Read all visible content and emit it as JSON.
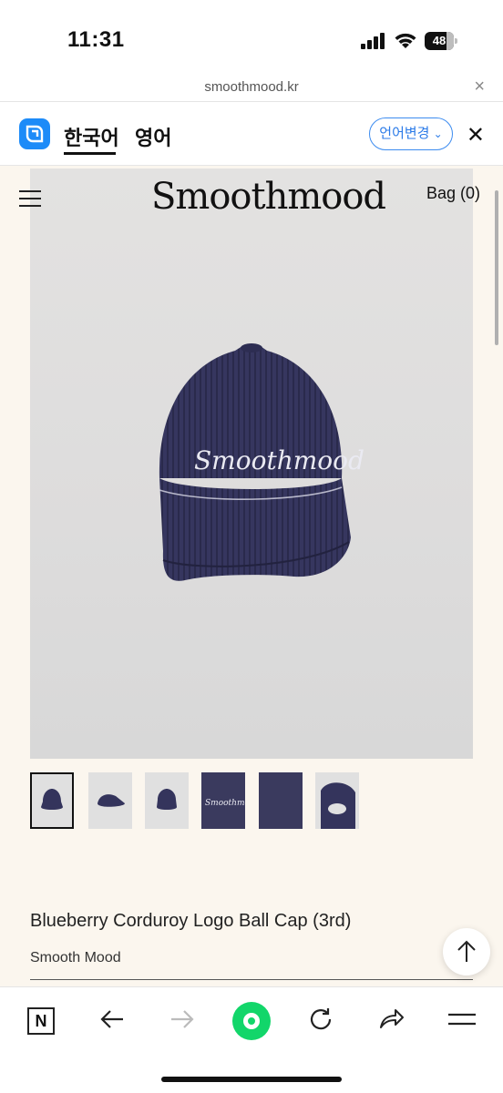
{
  "status_bar": {
    "time": "11:31",
    "battery": "48"
  },
  "browser": {
    "url": "smoothmood.kr"
  },
  "translate_bar": {
    "tab_korean": "한국어",
    "tab_english": "영어",
    "change_language": "언어변경",
    "colors": {
      "accent": "#2b7be8",
      "papago": "#1d8bf8"
    }
  },
  "site_header": {
    "brand_logo": "Smoothmood",
    "bag": "Bag (0)"
  },
  "product": {
    "image_alt_logo": "Smoothmood",
    "title": "Blueberry Corduroy Logo Ball Cap (3rd)",
    "brand": "Smooth Mood",
    "thumbnails": [
      "thumb-front",
      "thumb-side",
      "thumb-model",
      "thumb-logo-detail",
      "thumb-brim-detail",
      "thumb-back"
    ],
    "selected_thumbnail": 1
  },
  "bottom_nav": {
    "icons": [
      "naver-n-icon",
      "back-arrow-icon",
      "forward-arrow-icon",
      "green-circle-icon",
      "reload-icon",
      "share-icon",
      "menu-icon"
    ],
    "green": "#12d66a"
  }
}
